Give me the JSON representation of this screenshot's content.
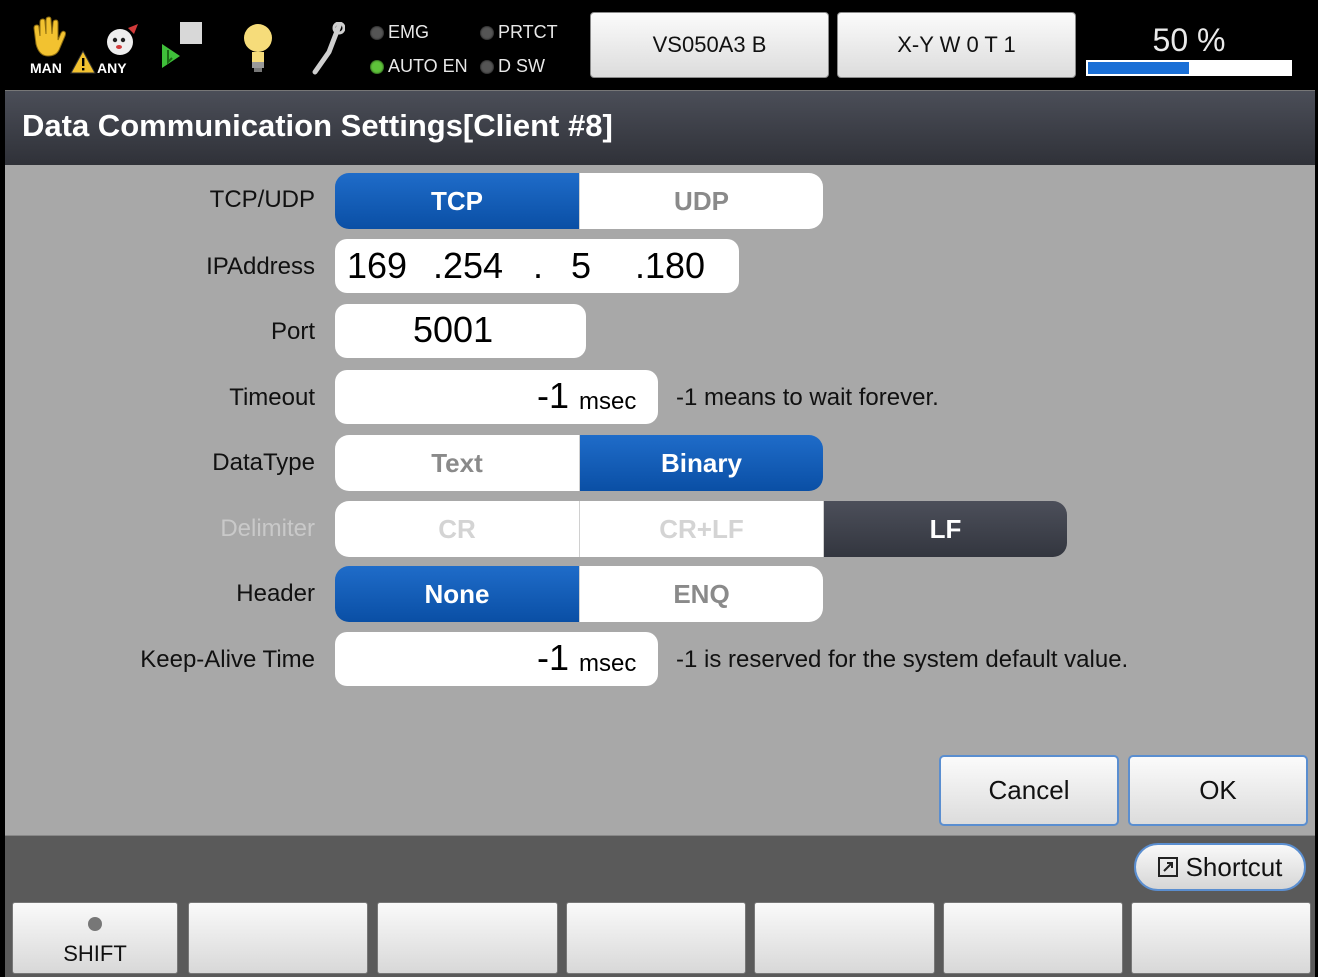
{
  "status_bar": {
    "mode_label": "MAN",
    "permission_label": "ANY",
    "leds": [
      {
        "label": "EMG",
        "state": "off"
      },
      {
        "label": "PRTCT",
        "state": "off"
      },
      {
        "label": "AUTO EN",
        "state": "on"
      },
      {
        "label": "D SW",
        "state": "off"
      }
    ],
    "robot_label": "VS050A3 B",
    "coord_label": "X-Y  W 0 T 1",
    "speed_text": "50 %",
    "speed_percent": 50,
    "icons": [
      "hand-icon",
      "warning-icon",
      "dog-icon",
      "program-run-icon",
      "lightbulb-icon",
      "wrench-icon"
    ],
    "colors": {
      "led_on": "#5ec23a",
      "speed_fill": "#1a6fd6"
    }
  },
  "title": "Data Communication Settings[Client #8]",
  "form": {
    "tcp_udp": {
      "label": "TCP/UDP",
      "options": [
        "TCP",
        "UDP"
      ],
      "selected": "TCP"
    },
    "ip": {
      "label": "IPAddress",
      "parts": [
        "169",
        ".254",
        ".",
        "5",
        ".180"
      ]
    },
    "port": {
      "label": "Port",
      "value": "5001"
    },
    "timeout": {
      "label": "Timeout",
      "value": "-1",
      "unit": "msec",
      "note": "-1 means to wait forever."
    },
    "data_type": {
      "label": "DataType",
      "options": [
        "Text",
        "Binary"
      ],
      "selected": "Binary"
    },
    "delimiter": {
      "label": "Delimiter",
      "options": [
        "CR",
        "CR+LF",
        "LF"
      ],
      "selected": "LF",
      "disabled": true
    },
    "header": {
      "label": "Header",
      "options": [
        "None",
        "ENQ"
      ],
      "selected": "None"
    },
    "keep_alive": {
      "label": "Keep-Alive Time",
      "value": "-1",
      "unit": "msec",
      "note": "-1 is reserved for the system default value."
    }
  },
  "actions": {
    "cancel": "Cancel",
    "ok": "OK"
  },
  "bottom": {
    "shortcut": "Shortcut",
    "fkeys": [
      "SHIFT",
      "",
      "",
      "",
      "",
      "",
      ""
    ]
  },
  "colors": {
    "selected_blue": "#0a4fa5",
    "content_bg": "#a8a8a8",
    "accent_border": "#5a8ed0"
  }
}
